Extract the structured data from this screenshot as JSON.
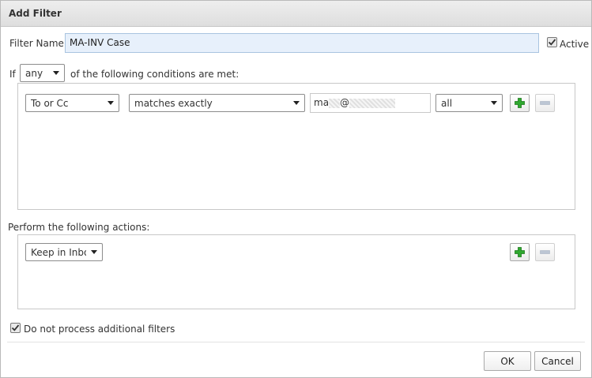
{
  "dialog": {
    "title": "Add Filter"
  },
  "filter_name": {
    "label": "Filter Name:",
    "value": "MA-INV Case"
  },
  "active": {
    "label": "Active",
    "checked": true
  },
  "conditions": {
    "if_label": "If",
    "match_type": "any",
    "suffix": "of the following conditions are met:",
    "rows": [
      {
        "field": "To or Cc",
        "operator": "matches exactly",
        "value_prefix": "ma",
        "value_at": "@",
        "scope": "all"
      }
    ]
  },
  "actions": {
    "heading": "Perform the following actions:",
    "rows": [
      {
        "action": "Keep in Inbox"
      }
    ]
  },
  "stop_processing": {
    "label": "Do not process additional filters",
    "checked": true
  },
  "buttons": {
    "ok": "OK",
    "cancel": "Cancel"
  },
  "colors": {
    "plus_green": "#2fa82f",
    "minus_gray": "#bcc6d4",
    "field_highlight": "#e7f0fb"
  }
}
